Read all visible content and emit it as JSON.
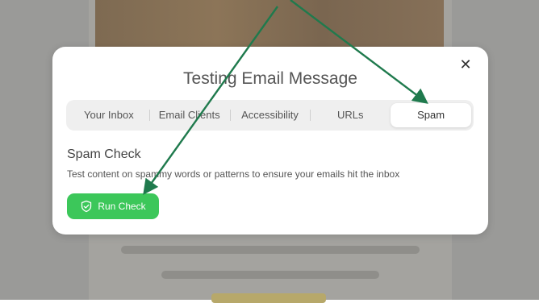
{
  "modal": {
    "title": "Testing Email Message",
    "close_label": "✕",
    "tabs": [
      {
        "label": "Your Inbox"
      },
      {
        "label": "Email Clients"
      },
      {
        "label": "Accessibility"
      },
      {
        "label": "URLs"
      },
      {
        "label": "Spam",
        "active": true
      }
    ],
    "section": {
      "title": "Spam Check",
      "description": "Test content on spammy words or patterns to ensure your emails hit the inbox",
      "button_label": "Run Check",
      "button_icon": "shield-check-icon"
    }
  },
  "colors": {
    "accent_green": "#3cc75a",
    "annotation_arrow": "#1f7a4d"
  }
}
